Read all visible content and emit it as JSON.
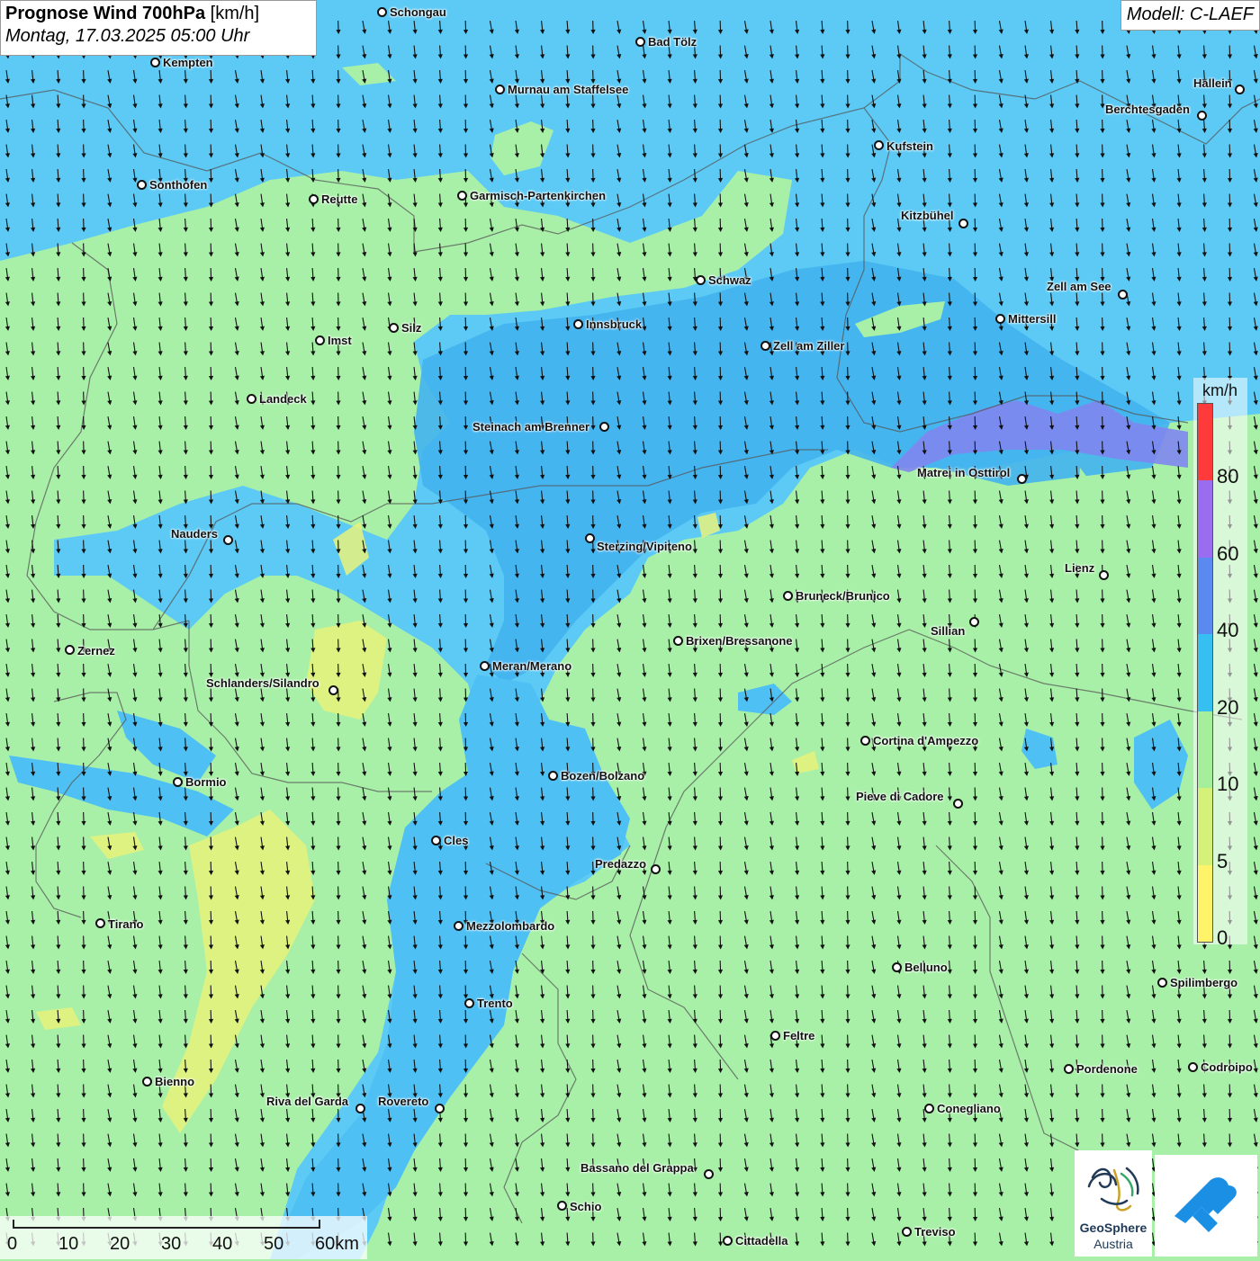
{
  "title": {
    "main": "Prognose Wind 700hPa",
    "unit": "[km/h]",
    "datetime": "Montag, 17.03.2025 05:00 Uhr"
  },
  "model": "Modell: C-LAEF",
  "legend": {
    "unit": "km/h",
    "ticks": [
      "80",
      "60",
      "40",
      "20",
      "10",
      "5",
      "0"
    ],
    "colors": [
      "#ff3a3a",
      "#9a6cf0",
      "#5a8af0",
      "#36c0f2",
      "#a4ee9c",
      "#d4f27a",
      "#fff36a"
    ]
  },
  "scale_bar": {
    "ticks": [
      "0",
      "10",
      "20",
      "30",
      "40",
      "50",
      "60km"
    ]
  },
  "logo": {
    "name": "GeoSphere",
    "sub": "Austria"
  },
  "colors": {
    "blue_wind": "#4fc6f3",
    "blue_dark": "#3aa8ef",
    "green_wind": "#a8f0a8",
    "yellow_wind": "#e8f27a",
    "purple_wind": "#7f86ef",
    "border": "#555555"
  },
  "cities": [
    {
      "name": "Schongau"
    },
    {
      "name": "Bad Tölz"
    },
    {
      "name": "Kempten"
    },
    {
      "name": "Murnau am Staffelsee"
    },
    {
      "name": "Hallein"
    },
    {
      "name": "Berchtesgaden"
    },
    {
      "name": "Kufstein"
    },
    {
      "name": "Sonthofen"
    },
    {
      "name": "Reutte"
    },
    {
      "name": "Garmisch-Partenkirchen"
    },
    {
      "name": "Kitzbühel"
    },
    {
      "name": "Schwaz"
    },
    {
      "name": "Zell am See"
    },
    {
      "name": "Mittersill"
    },
    {
      "name": "Innsbruck"
    },
    {
      "name": "Silz"
    },
    {
      "name": "Imst"
    },
    {
      "name": "Zell am Ziller"
    },
    {
      "name": "Landeck"
    },
    {
      "name": "Steinach am Brenner"
    },
    {
      "name": "Matrei in Osttirol"
    },
    {
      "name": "Nauders"
    },
    {
      "name": "Sterzing/Vipiteno"
    },
    {
      "name": "Lienz"
    },
    {
      "name": "Bruneck/Brunico"
    },
    {
      "name": "Sillian"
    },
    {
      "name": "Zernez"
    },
    {
      "name": "Brixen/Bressanone"
    },
    {
      "name": "Meran/Merano"
    },
    {
      "name": "Schlanders/Silandro"
    },
    {
      "name": "Cortina d'Ampezzo"
    },
    {
      "name": "Bozen/Bolzano"
    },
    {
      "name": "Bormio"
    },
    {
      "name": "Pieve di Cadore"
    },
    {
      "name": "Cles"
    },
    {
      "name": "Predazzo"
    },
    {
      "name": "Tirano"
    },
    {
      "name": "Mezzolombardo"
    },
    {
      "name": "Belluno"
    },
    {
      "name": "Spilimbergo"
    },
    {
      "name": "Trento"
    },
    {
      "name": "Feltre"
    },
    {
      "name": "Pordenone"
    },
    {
      "name": "Codroipo"
    },
    {
      "name": "Bienno"
    },
    {
      "name": "Riva del Garda"
    },
    {
      "name": "Rovereto"
    },
    {
      "name": "Conegliano"
    },
    {
      "name": "Bassano del Grappa"
    },
    {
      "name": "Schio"
    },
    {
      "name": "Treviso"
    },
    {
      "name": "Cittadella"
    }
  ]
}
